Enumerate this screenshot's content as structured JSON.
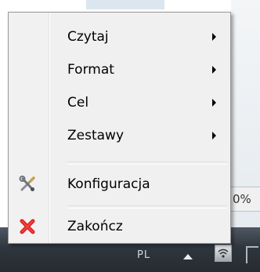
{
  "menu": {
    "items": [
      {
        "label": "Czytaj",
        "has_submenu": true
      },
      {
        "label": "Format",
        "has_submenu": true
      },
      {
        "label": "Cel",
        "has_submenu": true
      },
      {
        "label": "Zestawy",
        "has_submenu": true
      },
      {
        "label": "Konfiguracja",
        "icon": "tools-icon"
      },
      {
        "label": "Zakończ",
        "icon": "close-icon"
      }
    ]
  },
  "background": {
    "percent_text": "0%"
  },
  "taskbar": {
    "language": "PL",
    "icons": [
      "show-hidden-icons-arrow-icon",
      "network-icon"
    ]
  },
  "colors": {
    "menu_bg": "#f0f0f0",
    "close_red": "#e02020",
    "taskbar": "#2f363d"
  }
}
